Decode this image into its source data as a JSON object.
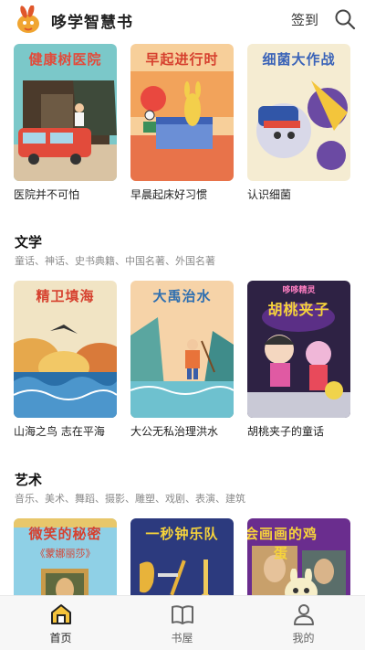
{
  "header": {
    "app_title": "哆学智慧书",
    "signin_label": "签到"
  },
  "top_books": [
    {
      "cover_title": "健康树医院",
      "title": "医院并不可怕"
    },
    {
      "cover_title": "早起进行时",
      "title": "早晨起床好习惯"
    },
    {
      "cover_title": "细菌大作战",
      "title": "认识细菌"
    }
  ],
  "sections": [
    {
      "title": "文学",
      "subtitle": "童话、神话、史书典籍、中国名著、外国名著",
      "books": [
        {
          "cover_title": "精卫填海",
          "title": "山海之鸟 志在平海"
        },
        {
          "cover_title": "大禹治水",
          "title": "大公无私治理洪水"
        },
        {
          "cover_title": "胡桃夹子",
          "cover_small": "哆哆精灵",
          "title": "胡桃夹子的童话"
        }
      ]
    },
    {
      "title": "艺术",
      "subtitle": "音乐、美术、舞蹈、摄影、雕塑、戏剧、表演、建筑",
      "books": [
        {
          "cover_title": "微笑的秘密",
          "cover_small": "《蒙娜丽莎》"
        },
        {
          "cover_title": "一秒钟乐队"
        },
        {
          "cover_title": "会画画的鸡蛋"
        }
      ]
    }
  ],
  "tabbar": {
    "items": [
      {
        "label": "首页",
        "active": true
      },
      {
        "label": "书屋",
        "active": false
      },
      {
        "label": "我的",
        "active": false
      }
    ]
  },
  "colors": {
    "accent": "#f0a531",
    "header_title": "#222222",
    "subtitle": "#8a8a8a"
  }
}
